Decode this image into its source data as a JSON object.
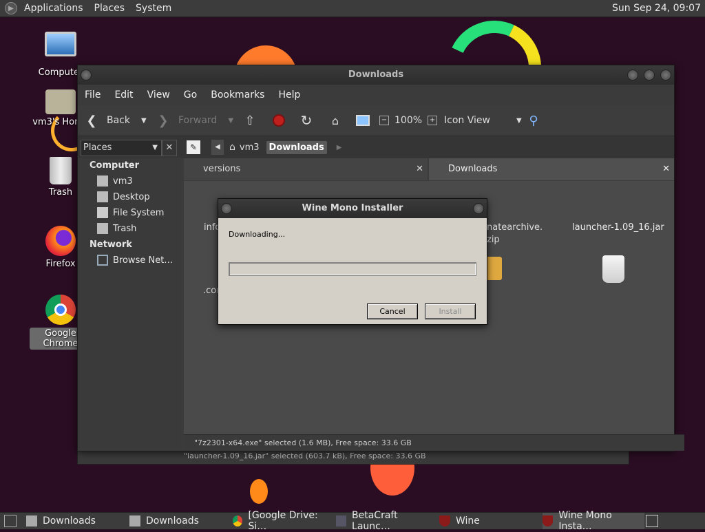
{
  "top_panel": {
    "menus": [
      "Applications",
      "Places",
      "System"
    ],
    "clock": "Sun Sep 24, 09:07"
  },
  "desktop_icons": [
    {
      "label": "Computer",
      "icon": "computer-icon"
    },
    {
      "label": "vm3's Home",
      "icon": "home-folder-icon"
    },
    {
      "label": "Trash",
      "icon": "trash-icon"
    },
    {
      "label": "Firefox",
      "icon": "firefox-icon"
    },
    {
      "label": "Google Chrome",
      "icon": "chrome-icon"
    }
  ],
  "file_manager": {
    "title": "Downloads",
    "menu": [
      "File",
      "Edit",
      "View",
      "Go",
      "Bookmarks",
      "Help"
    ],
    "toolbar": {
      "back": "Back",
      "forward": "Forward",
      "zoom": "100%",
      "view_mode": "Icon View"
    },
    "location": {
      "places_selector": "Places",
      "crumbs": [
        "vm3",
        "Downloads"
      ]
    },
    "sidebar": {
      "computer_heading": "Computer",
      "computer_items": [
        "vm3",
        "Desktop",
        "File System",
        "Trash"
      ],
      "network_heading": "Network",
      "network_items": [
        "Browse Net…"
      ]
    },
    "panes": [
      {
        "tab": "versions",
        "visible_labels": [
          "info",
          ".cor"
        ]
      },
      {
        "tab": "Downloads",
        "visible_labels": [
          "natearchive.",
          "zip",
          "launcher-1.09_16.jar"
        ]
      }
    ],
    "status_left": "\"7z2301-x64.exe\" selected (1.6 MB), Free space: 33.6 GB",
    "status_back": "\"launcher-1.09_16.jar\" selected (603.7 kB), Free space: 33.6 GB"
  },
  "wine_dialog": {
    "title": "Wine Mono Installer",
    "message": "Downloading...",
    "progress": 0,
    "cancel_label": "Cancel",
    "install_label": "Install"
  },
  "taskbar": {
    "tasks": [
      {
        "label": "Downloads",
        "icon": "folder-icon"
      },
      {
        "label": "Downloads",
        "icon": "folder-icon"
      },
      {
        "label": "[Google Drive: Si…",
        "icon": "chrome-icon"
      },
      {
        "label": "BetaCraft Launc…",
        "icon": "java-icon"
      },
      {
        "label": "Wine",
        "icon": "wine-icon"
      },
      {
        "label": "Wine Mono Insta…",
        "icon": "wine-icon"
      }
    ]
  }
}
